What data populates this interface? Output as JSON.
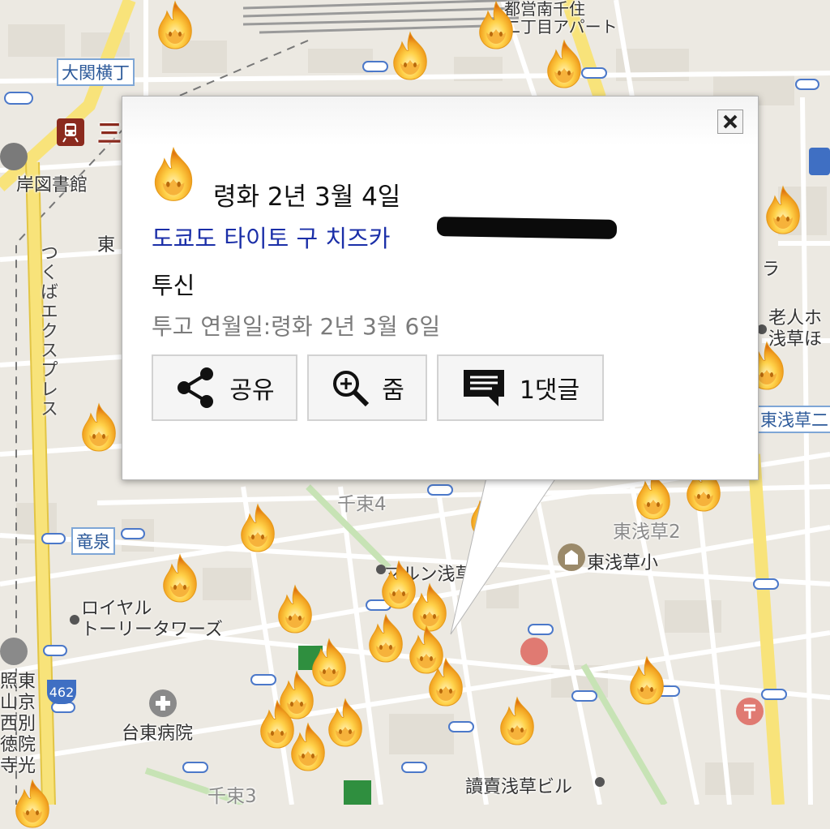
{
  "map": {
    "labels": {
      "oozeki_yokocho": "大関横丁",
      "ryusen": "竜泉",
      "senzoku4": "千束4",
      "senzoku3": "千束3",
      "higashi_asakusa2": "東浅草2",
      "higashi_asakusa_sho": "東浅草小",
      "royal_tower": "ロイヤル\nトーリータワーズ",
      "taito_hospital": "台東病院",
      "yomiuri_bldg": "讀賣浅草ビル",
      "maruon": "マルン浅草",
      "kishi_library": "岸図書館",
      "higashi_left": "東",
      "minowa_partial": "三",
      "apart": "都営南千住\n二丁目アパート",
      "rojin": "老人ホ\n浅草ほ",
      "higashi_asakusa_right": "東浅草二",
      "ra": "ラ",
      "tsukuba": "つくばエクスプレス",
      "route462": "462",
      "left_vertical": "照東\n山京\n西別\n徳院\n寺光"
    }
  },
  "popup": {
    "date": "령화 2년 3월 4일",
    "address": "도쿄도 타이토 구 치즈카 ",
    "type": "투신",
    "posted": "투고 연월일:령화 2년 3월 6일",
    "actions": {
      "share": "공유",
      "zoom": "줌",
      "comments": "1댓글"
    },
    "close_label": "×"
  },
  "colors": {
    "map_bg": "#ece9e2",
    "major_road": "#f8e37a",
    "link_blue": "#1b2fa8",
    "fire_orange": "#f2a321"
  },
  "icons": {
    "marker": "fire-icon",
    "share": "share-icon",
    "zoom": "zoom-in-icon",
    "comments": "comment-icon",
    "close": "close-icon",
    "station": "train-icon"
  }
}
